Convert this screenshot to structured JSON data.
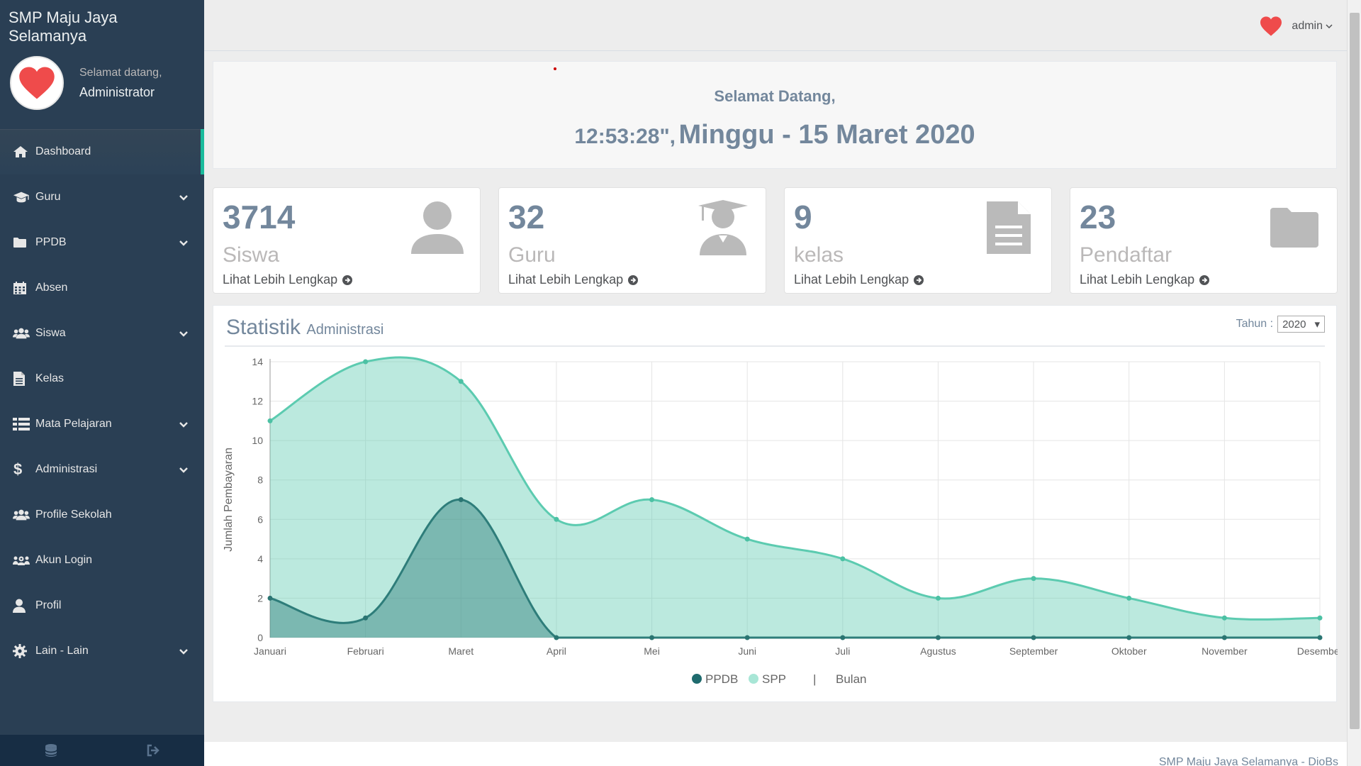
{
  "sidebar": {
    "brand": "SMP Maju Jaya Selamanya",
    "welcome": "Selamat datang,",
    "user": "Administrator",
    "items": [
      {
        "label": "Dashboard",
        "icon": "home-icon",
        "active": true,
        "chevron": false
      },
      {
        "label": "Guru",
        "icon": "graduation-cap-icon",
        "chevron": true
      },
      {
        "label": "PPDB",
        "icon": "folder-icon",
        "chevron": true
      },
      {
        "label": "Absen",
        "icon": "calendar-icon",
        "chevron": false
      },
      {
        "label": "Siswa",
        "icon": "users-icon",
        "chevron": true
      },
      {
        "label": "Kelas",
        "icon": "file-text-icon",
        "chevron": false
      },
      {
        "label": "Mata Pelajaran",
        "icon": "table-icon",
        "chevron": true
      },
      {
        "label": "Administrasi",
        "icon": "dollar-icon",
        "chevron": true
      },
      {
        "label": "Profile Sekolah",
        "icon": "users-icon",
        "chevron": false
      },
      {
        "label": "Akun Login",
        "icon": "users-cog-icon",
        "chevron": false
      },
      {
        "label": "Profil",
        "icon": "user-icon",
        "chevron": false
      },
      {
        "label": "Lain - Lain",
        "icon": "gear-icon",
        "chevron": true
      }
    ]
  },
  "topnav": {
    "user": "admin"
  },
  "welcome": {
    "greeting": "Selamat Datang,",
    "time": "12:53:28\",",
    "date": "Minggu - 15 Maret 2020"
  },
  "tiles": [
    {
      "count": "3714",
      "label": "Siswa",
      "link": "Lihat Lebih Lengkap",
      "icon": "user-icon"
    },
    {
      "count": "32",
      "label": "Guru",
      "link": "Lihat Lebih Lengkap",
      "icon": "teacher-icon"
    },
    {
      "count": "9",
      "label": "kelas",
      "link": "Lihat Lebih Lengkap",
      "icon": "document-icon"
    },
    {
      "count": "23",
      "label": "Pendaftar",
      "link": "Lihat Lebih Lengkap",
      "icon": "folder-icon"
    }
  ],
  "stat": {
    "title": "Statistik",
    "subtitle": "Administrasi",
    "year_label": "Tahun :",
    "year_value": "2020"
  },
  "colors": {
    "sidebar": "#2a3f54",
    "accent": "#1abb9c",
    "spp": "#5ccbb0",
    "ppdb": "#2e7d7a"
  },
  "chart_data": {
    "type": "area",
    "categories": [
      "Januari",
      "Februari",
      "Maret",
      "April",
      "Mei",
      "Juni",
      "Juli",
      "Agustus",
      "September",
      "Oktober",
      "November",
      "Desember"
    ],
    "ylabel": "Jumlah Pembayaran",
    "ylim": [
      0,
      14
    ],
    "yticks": [
      0,
      2,
      4,
      6,
      8,
      10,
      12,
      14
    ],
    "grid": true,
    "legend_position": "bottom",
    "series": [
      {
        "name": "PPDB",
        "values": [
          2,
          1,
          7,
          0,
          0,
          0,
          0,
          0,
          0,
          0,
          0,
          0
        ]
      },
      {
        "name": "SPP",
        "values": [
          11,
          14,
          13,
          6,
          7,
          5,
          4,
          2,
          3,
          2,
          1,
          1
        ]
      }
    ],
    "legend_extra": "Bulan"
  },
  "footer": "SMP Maju Jaya Selamanya - DioBs"
}
